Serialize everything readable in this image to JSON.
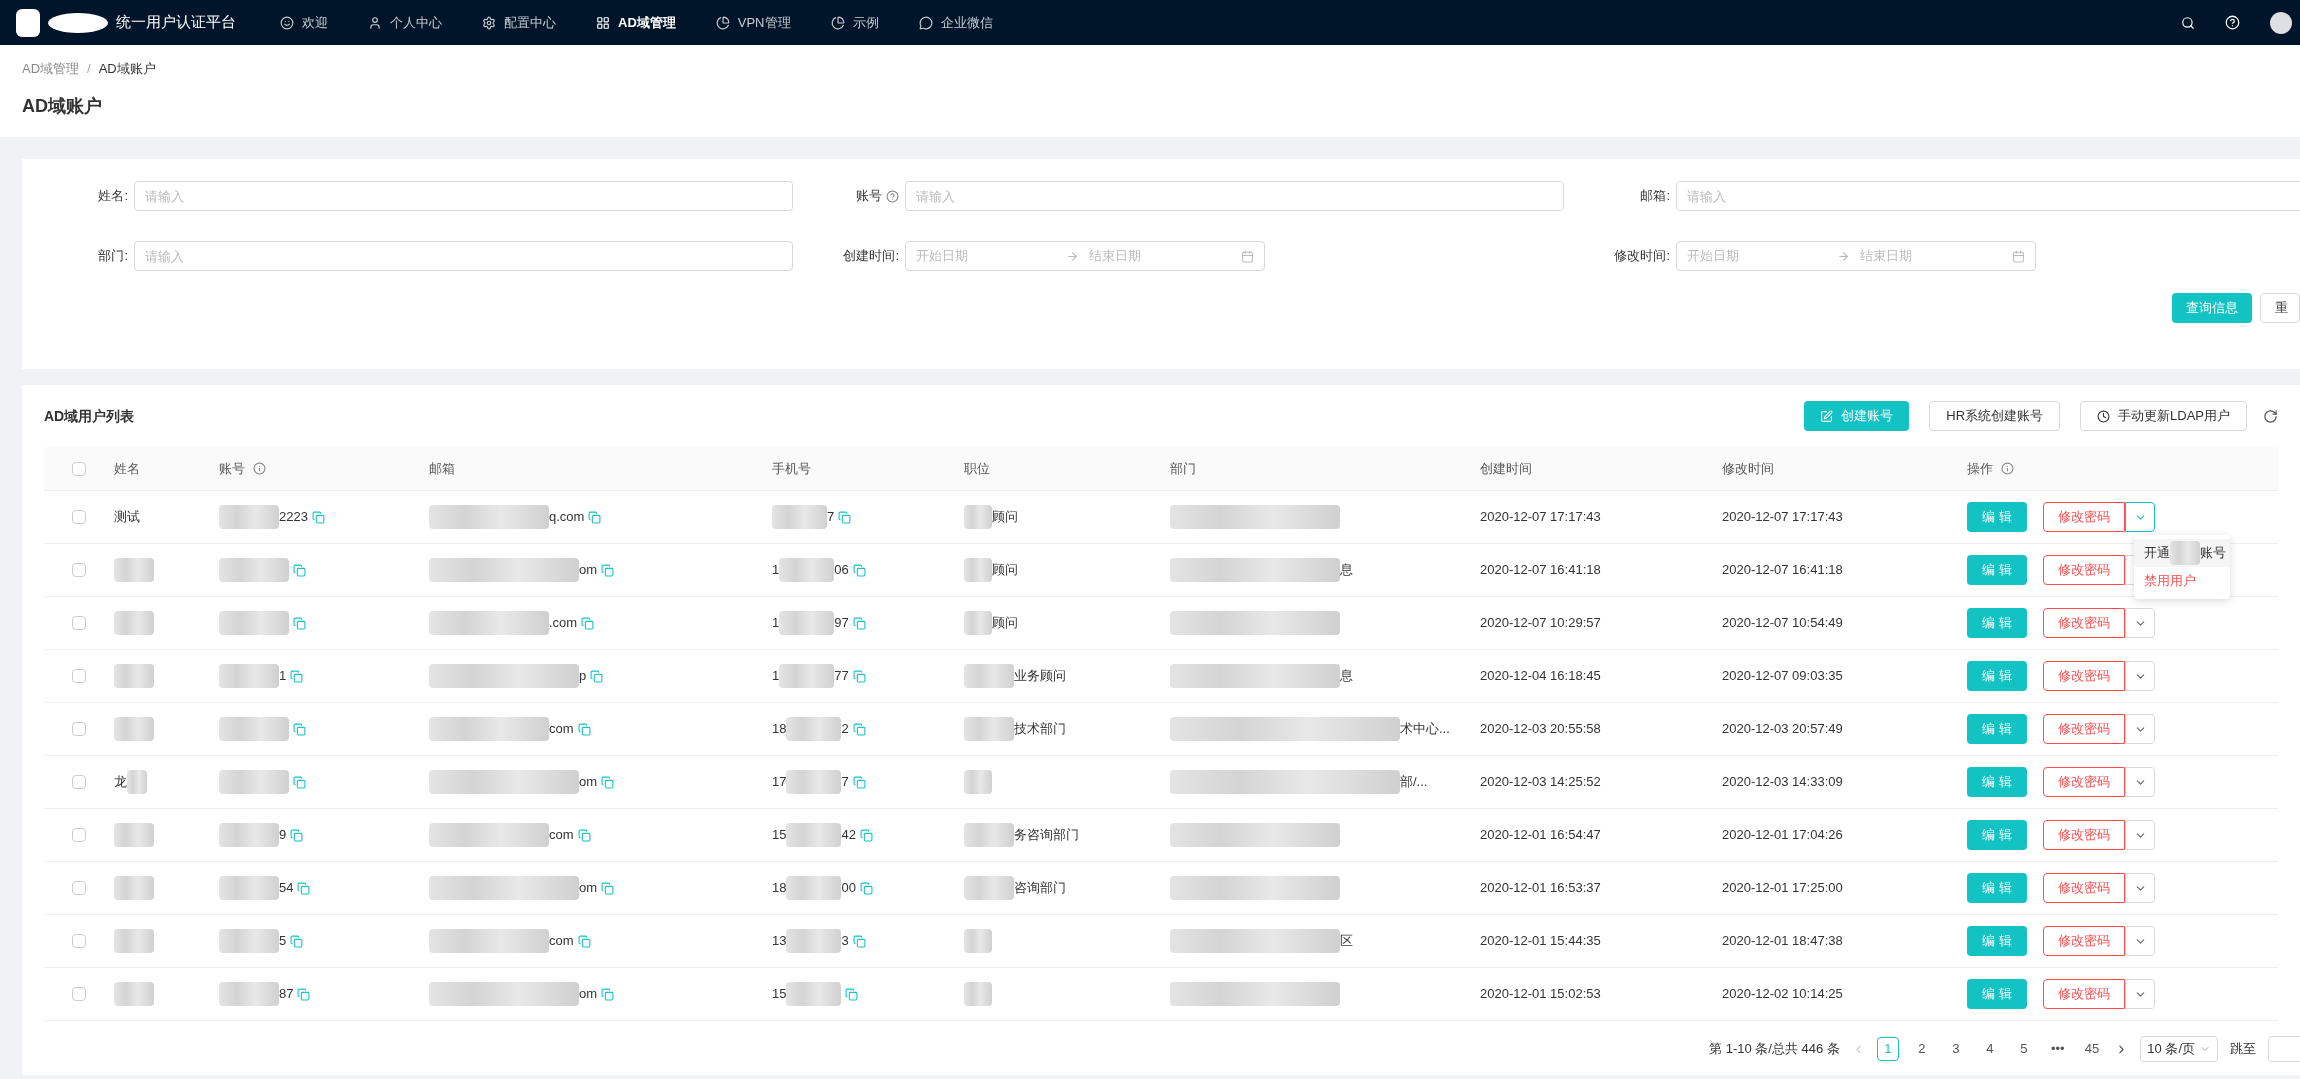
{
  "nav": {
    "title": "统一用户认证平台",
    "items": [
      {
        "label": "欢迎",
        "selected": false
      },
      {
        "label": "个人中心",
        "selected": false
      },
      {
        "label": "配置中心",
        "selected": false
      },
      {
        "label": "AD域管理",
        "selected": true
      },
      {
        "label": "VPN管理",
        "selected": false
      },
      {
        "label": "示例",
        "selected": false
      },
      {
        "label": "企业微信",
        "selected": false
      }
    ]
  },
  "breadcrumb": {
    "parent": "AD域管理",
    "separator": "/",
    "current": "AD域账户"
  },
  "page_title": "AD域账户",
  "search": {
    "fields": [
      {
        "kind": "text",
        "label": "姓名:",
        "placeholder": "请输入"
      },
      {
        "kind": "text",
        "label": "账号",
        "placeholder": "请输入"
      },
      {
        "kind": "text",
        "label": "邮箱:",
        "placeholder": "请输入"
      },
      {
        "kind": "text",
        "label": "部门:",
        "placeholder": "请输入"
      },
      {
        "kind": "range",
        "label": "创建时间:",
        "start": "开始日期",
        "end": "结束日期"
      },
      {
        "kind": "range",
        "label": "修改时间:",
        "start": "开始日期",
        "end": "结束日期"
      }
    ],
    "buttons": [
      {
        "kind": "primary",
        "label": "查询信息"
      },
      {
        "kind": "default",
        "label": "重"
      }
    ]
  },
  "list": {
    "title": "AD域用户列表",
    "actions": [
      {
        "kind": "primary",
        "label": "创建账号"
      },
      {
        "kind": "default",
        "label": "HR系统创建账号"
      },
      {
        "kind": "default",
        "label": "手动更新LDAP用户"
      }
    ],
    "select_all_checked": false,
    "columns": [
      "姓名",
      "账号",
      "邮箱",
      "手机号",
      "职位",
      "部门",
      "创建时间",
      "修改时间",
      "操作"
    ],
    "menu": [
      {
        "kind": "normal",
        "text": "开通",
        "suffix": "账号"
      },
      {
        "kind": "danger",
        "text": "禁用用户"
      }
    ],
    "rows": [
      {
        "checked": false,
        "name": "测试",
        "account": "2223",
        "email": "q.com",
        "phone_prefix": "",
        "phone_suffix": "7",
        "position": "顾问",
        "department": "",
        "created": "2020-12-07 17:17:43",
        "modified": "2020-12-07 17:17:43",
        "edit": "编 辑",
        "password": "修改密码",
        "menu_open": true
      },
      {
        "checked": false,
        "name": "",
        "account": "",
        "email": "om",
        "phone_prefix": "1",
        "phone_suffix": "06",
        "position": "顾问",
        "department": "息",
        "created": "2020-12-07 16:41:18",
        "modified": "2020-12-07 16:41:18",
        "edit": "编 辑",
        "password": "修改密码",
        "menu_open": false
      },
      {
        "checked": false,
        "name": "",
        "account": "",
        "email": ".com",
        "phone_prefix": "1",
        "phone_suffix": "97",
        "position": "顾问",
        "department": "",
        "created": "2020-12-07 10:29:57",
        "modified": "2020-12-07 10:54:49",
        "edit": "编 辑",
        "password": "修改密码",
        "menu_open": false
      },
      {
        "checked": false,
        "name": "",
        "account": "1",
        "email": "p",
        "phone_prefix": "1",
        "phone_suffix": "77",
        "position": "业务顾问",
        "department": "息",
        "created": "2020-12-04 16:18:45",
        "modified": "2020-12-07 09:03:35",
        "edit": "编 辑",
        "password": "修改密码",
        "menu_open": false
      },
      {
        "checked": false,
        "name": "",
        "account": "",
        "email": "com",
        "phone_prefix": "18",
        "phone_suffix": "2",
        "position": "技术部门",
        "department": "术中心...",
        "created": "2020-12-03 20:55:58",
        "modified": "2020-12-03 20:57:49",
        "edit": "编 辑",
        "password": "修改密码",
        "menu_open": false
      },
      {
        "checked": false,
        "name": "龙",
        "account": "",
        "email": "om",
        "phone_prefix": "17",
        "phone_suffix": "7",
        "position": "",
        "department": "部/...",
        "created": "2020-12-03 14:25:52",
        "modified": "2020-12-03 14:33:09",
        "edit": "编 辑",
        "password": "修改密码",
        "menu_open": false
      },
      {
        "checked": false,
        "name": "",
        "account": "9",
        "email": "com",
        "phone_prefix": "15",
        "phone_suffix": "42",
        "position": "务咨询部门",
        "department": "",
        "created": "2020-12-01 16:54:47",
        "modified": "2020-12-01 17:04:26",
        "edit": "编 辑",
        "password": "修改密码",
        "menu_open": false
      },
      {
        "checked": false,
        "name": "",
        "account": "54",
        "email": "om",
        "phone_prefix": "18",
        "phone_suffix": "00",
        "position": "咨询部门",
        "department": "",
        "created": "2020-12-01 16:53:37",
        "modified": "2020-12-01 17:25:00",
        "edit": "编 辑",
        "password": "修改密码",
        "menu_open": false
      },
      {
        "checked": false,
        "name": "",
        "account": "5",
        "email": "com",
        "phone_prefix": "13",
        "phone_suffix": "3",
        "position": "",
        "department": "区",
        "created": "2020-12-01 15:44:35",
        "modified": "2020-12-01 18:47:38",
        "edit": "编 辑",
        "password": "修改密码",
        "menu_open": false
      },
      {
        "checked": false,
        "name": "",
        "account": "87",
        "email": "om",
        "phone_prefix": "15",
        "phone_suffix": "",
        "position": "",
        "department": "",
        "created": "2020-12-01 15:02:53",
        "modified": "2020-12-02 10:14:25",
        "edit": "编 辑",
        "password": "修改密码",
        "menu_open": false
      }
    ]
  },
  "pagination": {
    "summary": "第 1-10 条/总共 446 条",
    "pages": [
      {
        "label": "1",
        "selected": true
      },
      {
        "label": "2",
        "selected": false
      },
      {
        "label": "3",
        "selected": false
      },
      {
        "label": "4",
        "selected": false
      },
      {
        "label": "5",
        "selected": false
      },
      {
        "label": "•••",
        "selected": false
      },
      {
        "label": "45",
        "selected": false
      }
    ],
    "page_size": "10 条/页",
    "jump_label": "跳至"
  }
}
